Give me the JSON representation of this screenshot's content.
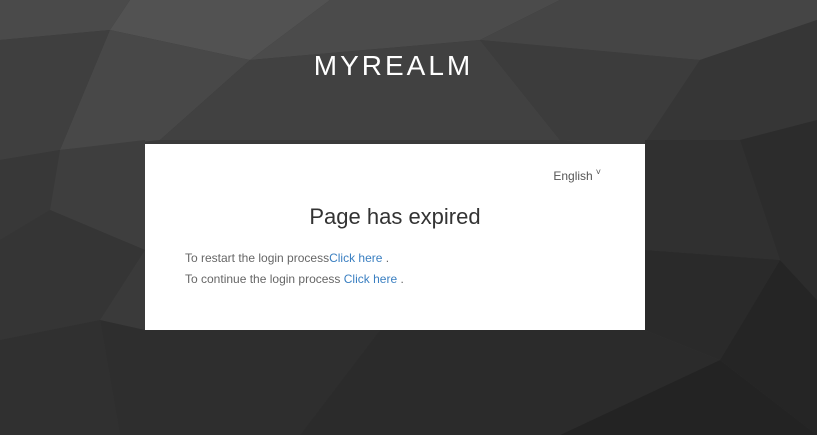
{
  "realm": {
    "name": "MYREALM"
  },
  "locale": {
    "current": "English",
    "caret": "˅"
  },
  "page": {
    "title": "Page has expired"
  },
  "instructions": {
    "restart_text": "To restart the login process",
    "restart_link": "Click here",
    "restart_suffix": " .",
    "continue_text": "To continue the login process ",
    "continue_link": "Click here",
    "continue_suffix": " ."
  },
  "colors": {
    "link": "#3a7fc1",
    "background": "#3a3a3a",
    "card": "#ffffff"
  }
}
